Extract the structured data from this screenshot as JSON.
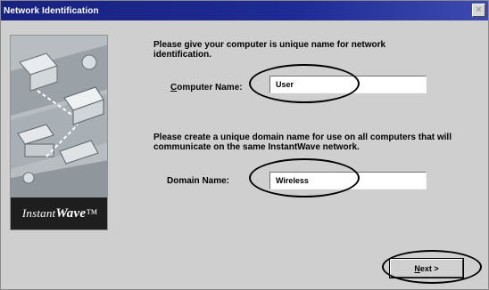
{
  "window": {
    "title": "Network Identification",
    "close_glyph": "×"
  },
  "sidebar": {
    "brand_prefix": "Instant",
    "brand_suffix": "Wave",
    "brand_mark": "™",
    "image_icon": "network-illustration-icon"
  },
  "computer_section": {
    "instruction": "Please give your computer is unique name for network identification.",
    "label_hotkey": "C",
    "label_rest": "omputer Name:",
    "value": "User"
  },
  "domain_section": {
    "instruction": "Please create a unique domain name for use on all computers that will communicate on the same InstantWave network.",
    "label": "Domain Name:",
    "value": "Wireless"
  },
  "footer": {
    "next_hotkey": "N",
    "next_rest": "ext >"
  },
  "colors": {
    "titlebar": "#1e2b95",
    "dialog_bg": "#cfcfcf",
    "annotation": "#000000"
  }
}
